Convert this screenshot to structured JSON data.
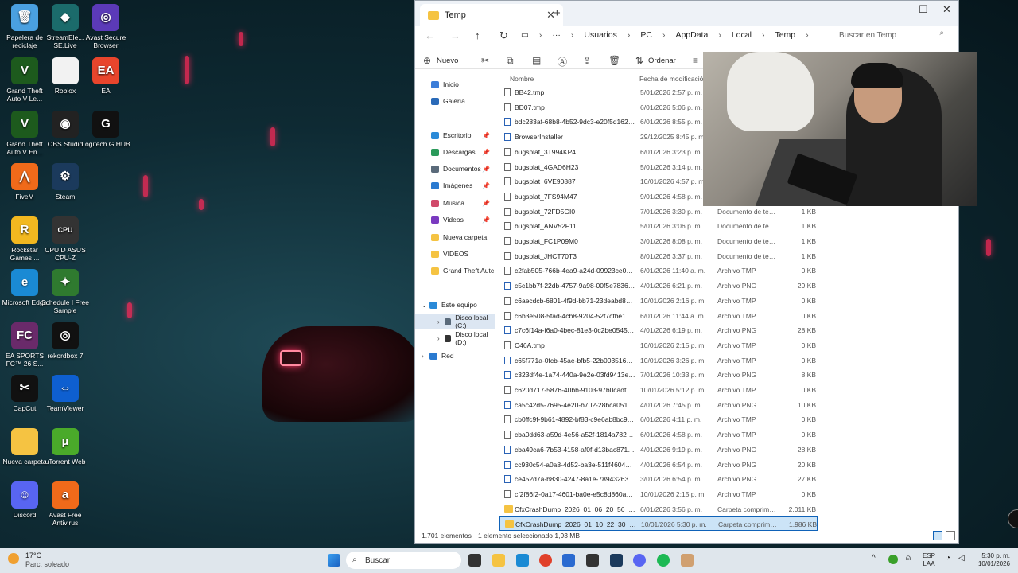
{
  "desktop": {
    "icons": [
      {
        "label": "Papelera de reciclaje",
        "icon": "recycle-bin-icon",
        "color": "#4aa0e0",
        "glyph": "🗑"
      },
      {
        "label": "StreamEle... SE.Live",
        "icon": "streamelements-icon",
        "color": "#1b6b6b",
        "glyph": "◆"
      },
      {
        "label": "Avast Secure Browser",
        "icon": "avast-browser-icon",
        "color": "#5b3ab8",
        "glyph": "◎"
      },
      {
        "label": "Grand Theft Auto V Le...",
        "icon": "gta-icon",
        "color": "#1d5a1d",
        "glyph": "V"
      },
      {
        "label": "Roblox",
        "icon": "file-icon",
        "color": "#f2f2f2",
        "glyph": ""
      },
      {
        "label": "EA",
        "icon": "ea-icon",
        "color": "#e8452c",
        "glyph": "EA"
      },
      {
        "label": "Grand Theft Auto V En...",
        "icon": "gta-icon",
        "color": "#1d5a1d",
        "glyph": "V"
      },
      {
        "label": "OBS Studio",
        "icon": "obs-icon",
        "color": "#222222",
        "glyph": "◉"
      },
      {
        "label": "Logitech G HUB",
        "icon": "logitech-icon",
        "color": "#111111",
        "glyph": "G"
      },
      {
        "label": "FiveM",
        "icon": "fivem-icon",
        "color": "#f06a1a",
        "glyph": "⋀"
      },
      {
        "label": "Steam",
        "icon": "steam-icon",
        "color": "#1b3a5c",
        "glyph": "⚙"
      },
      {
        "label": "Rockstar Games ...",
        "icon": "rockstar-icon",
        "color": "#f2b820",
        "glyph": "R"
      },
      {
        "label": "CPUID ASUS CPU-Z",
        "icon": "cpuz-icon",
        "color": "#333333",
        "glyph": "CPU"
      },
      {
        "label": "Microsoft Edge",
        "icon": "edge-icon",
        "color": "#1a8ad4",
        "glyph": "e"
      },
      {
        "label": "Schedule I Free Sample",
        "icon": "schedule-icon",
        "color": "#2f7a2f",
        "glyph": "✦"
      },
      {
        "label": "EA SPORTS FC™ 26 S...",
        "icon": "easports-icon",
        "color": "#6a2a6a",
        "glyph": "FC"
      },
      {
        "label": "rekordbox 7",
        "icon": "rekordbox-icon",
        "color": "#111111",
        "glyph": "◎"
      },
      {
        "label": "CapCut",
        "icon": "capcut-icon",
        "color": "#111111",
        "glyph": "✂"
      },
      {
        "label": "TeamViewer",
        "icon": "teamviewer-icon",
        "color": "#0e5fd0",
        "glyph": "⇔"
      },
      {
        "label": "Nueva carpeta",
        "icon": "folder-icon",
        "color": "#f5c342",
        "glyph": ""
      },
      {
        "label": "uTorrent Web",
        "icon": "utorrent-icon",
        "color": "#4aaa2a",
        "glyph": "µ"
      },
      {
        "label": "Discord",
        "icon": "discord-icon",
        "color": "#5865f2",
        "glyph": "☺"
      },
      {
        "label": "Avast Free Antivirus",
        "icon": "avast-icon",
        "color": "#f06a1a",
        "glyph": "a"
      }
    ]
  },
  "explorer": {
    "tab_title": "Temp",
    "breadcrumb": [
      "Usuarios",
      "PC",
      "AppData",
      "Local",
      "Temp"
    ],
    "ellipsis": "···",
    "search_placeholder": "Buscar en Temp",
    "toolbar": {
      "new_label": "Nuevo",
      "sort_label": "Ordenar"
    },
    "sidebar": [
      {
        "label": "Inicio",
        "icon": "home-icon",
        "color": "#3b7dd8",
        "pinned": false
      },
      {
        "label": "Galería",
        "icon": "gallery-icon",
        "color": "#2a6ab8",
        "pinned": false
      },
      {
        "label": "Escritorio",
        "icon": "desktop-icon",
        "color": "#2a8ad8",
        "pinned": true
      },
      {
        "label": "Descargas",
        "icon": "download-icon",
        "color": "#2a9a5a",
        "pinned": true
      },
      {
        "label": "Documentos",
        "icon": "documents-icon",
        "color": "#5a6a7a",
        "pinned": true
      },
      {
        "label": "Imágenes",
        "icon": "pictures-icon",
        "color": "#2a7ad0",
        "pinned": true
      },
      {
        "label": "Música",
        "icon": "music-icon",
        "color": "#d04a6a",
        "pinned": true
      },
      {
        "label": "Videos",
        "icon": "videos-icon",
        "color": "#7a3ac0",
        "pinned": true
      },
      {
        "label": "Nueva carpeta",
        "icon": "folder-icon",
        "color": "#f5c342",
        "pinned": false
      },
      {
        "label": "VIDEOS",
        "icon": "folder-icon",
        "color": "#f5c342",
        "pinned": false
      },
      {
        "label": "Grand Theft Autc",
        "icon": "folder-icon",
        "color": "#f5c342",
        "pinned": false
      },
      {
        "label": "Este equipo",
        "icon": "pc-icon",
        "color": "#2a8ad8",
        "pinned": false
      },
      {
        "label": "Disco local (C:)",
        "icon": "drive-icon",
        "color": "#5a6a7a",
        "pinned": false
      },
      {
        "label": "Disco local (D:)",
        "icon": "drive-icon",
        "color": "#333333",
        "pinned": false
      },
      {
        "label": "Red",
        "icon": "network-icon",
        "color": "#2a7ad0",
        "pinned": false
      }
    ],
    "columns": {
      "name": "Nombre",
      "date": "Fecha de modificación"
    },
    "files": [
      {
        "name": "BB42.tmp",
        "date": "5/01/2026 2:57 p. m.",
        "type": "",
        "size": "",
        "kind": "tmp"
      },
      {
        "name": "BD07.tmp",
        "date": "6/01/2026 5:06 p. m.",
        "type": "",
        "size": "",
        "kind": "tmp"
      },
      {
        "name": "bdc283af-68b8-4b52-9dc3-e20f5d16237c",
        "date": "6/01/2026 8:55 p. m.",
        "type": "",
        "size": "",
        "kind": "png"
      },
      {
        "name": "BrowserInstaller",
        "date": "29/12/2025 8:45 p. m.",
        "type": "",
        "size": "",
        "kind": "png"
      },
      {
        "name": "bugsplat_3T994KP4",
        "date": "6/01/2026 3:23 p. m.",
        "type": "",
        "size": "",
        "kind": "tmp"
      },
      {
        "name": "bugsplat_4GAD6H23",
        "date": "5/01/2026 3:14 p. m.",
        "type": "",
        "size": "",
        "kind": "tmp"
      },
      {
        "name": "bugsplat_6VE90887",
        "date": "10/01/2026 4:57 p. m.",
        "type": "",
        "size": "",
        "kind": "tmp"
      },
      {
        "name": "bugsplat_7FS94M47",
        "date": "9/01/2026 4:58 p. m.",
        "type": "",
        "size": "",
        "kind": "tmp"
      },
      {
        "name": "bugsplat_72FD5GI0",
        "date": "7/01/2026 3:30 p. m.",
        "type": "Documento de tex...",
        "size": "1 KB",
        "kind": "tmp"
      },
      {
        "name": "bugsplat_ANV52F11",
        "date": "5/01/2026 3:06 p. m.",
        "type": "Documento de tex...",
        "size": "1 KB",
        "kind": "tmp"
      },
      {
        "name": "bugsplat_FC1P09M0",
        "date": "3/01/2026 8:08 p. m.",
        "type": "Documento de tex...",
        "size": "1 KB",
        "kind": "tmp"
      },
      {
        "name": "bugsplat_JHCT70T3",
        "date": "8/01/2026 3:37 p. m.",
        "type": "Documento de tex...",
        "size": "1 KB",
        "kind": "tmp"
      },
      {
        "name": "c2fab505-766b-4ea9-a24d-09923ce092dc....",
        "date": "6/01/2026 11:40 a. m.",
        "type": "Archivo TMP",
        "size": "0 KB",
        "kind": "tmp"
      },
      {
        "name": "c5c1bb7f-22db-4757-9a98-00f5e7836ed4",
        "date": "4/01/2026 6:21 p. m.",
        "type": "Archivo PNG",
        "size": "29 KB",
        "kind": "png"
      },
      {
        "name": "c6aecdcb-6801-4f9d-bb71-23deabd87de...",
        "date": "10/01/2026 2:16 p. m.",
        "type": "Archivo TMP",
        "size": "0 KB",
        "kind": "tmp"
      },
      {
        "name": "c6b3e508-5fad-4cb8-9204-52f7cfbe10a4.t...",
        "date": "6/01/2026 11:44 a. m.",
        "type": "Archivo TMP",
        "size": "0 KB",
        "kind": "tmp"
      },
      {
        "name": "c7c6f14a-f6a0-4bec-81e3-0c2be0545dfe",
        "date": "4/01/2026 6:19 p. m.",
        "type": "Archivo PNG",
        "size": "28 KB",
        "kind": "png"
      },
      {
        "name": "C46A.tmp",
        "date": "10/01/2026 2:15 p. m.",
        "type": "Archivo TMP",
        "size": "0 KB",
        "kind": "tmp"
      },
      {
        "name": "c65f771a-0fcb-45ae-bfb5-22b003516266.t...",
        "date": "10/01/2026 3:26 p. m.",
        "type": "Archivo TMP",
        "size": "0 KB",
        "kind": "png"
      },
      {
        "name": "c323df4e-1a74-440a-9e2e-03fd9413e1cf",
        "date": "7/01/2026 10:33 p. m.",
        "type": "Archivo PNG",
        "size": "8 KB",
        "kind": "png"
      },
      {
        "name": "c620d717-5876-40bb-9103-97b0cadf18b1....",
        "date": "10/01/2026 5:12 p. m.",
        "type": "Archivo TMP",
        "size": "0 KB",
        "kind": "tmp"
      },
      {
        "name": "ca5c42d5-7695-4e20-b702-28bca0512048",
        "date": "4/01/2026 7:45 p. m.",
        "type": "Archivo PNG",
        "size": "10 KB",
        "kind": "png"
      },
      {
        "name": "cb0ffc9f-9b61-4892-bf83-c9e6ab8bc933.t...",
        "date": "6/01/2026 4:11 p. m.",
        "type": "Archivo TMP",
        "size": "0 KB",
        "kind": "tmp"
      },
      {
        "name": "cba0dd63-a59d-4e56-a52f-1814a78296fb....",
        "date": "6/01/2026 4:58 p. m.",
        "type": "Archivo TMP",
        "size": "0 KB",
        "kind": "tmp"
      },
      {
        "name": "cba49ca6-7b53-4158-af0f-d13bac871978",
        "date": "4/01/2026 9:19 p. m.",
        "type": "Archivo PNG",
        "size": "28 KB",
        "kind": "png"
      },
      {
        "name": "cc930c54-a0a8-4d52-ba3e-511f4604b83e",
        "date": "4/01/2026 6:54 p. m.",
        "type": "Archivo PNG",
        "size": "20 KB",
        "kind": "png"
      },
      {
        "name": "ce452d7a-b830-4247-8a1e-789432632e83",
        "date": "3/01/2026 6:54 p. m.",
        "type": "Archivo PNG",
        "size": "27 KB",
        "kind": "png"
      },
      {
        "name": "cf2f86f2-0a17-4601-ba0e-e5c8d860a025.t...",
        "date": "10/01/2026 2:15 p. m.",
        "type": "Archivo TMP",
        "size": "0 KB",
        "kind": "tmp"
      },
      {
        "name": "CfxCrashDump_2026_01_06_20_56_29",
        "date": "6/01/2026 3:56 p. m.",
        "type": "Carpeta comprimi...",
        "size": "2.011 KB",
        "kind": "zip"
      },
      {
        "name": "CfxCrashDump_2026_01_10_22_30_33",
        "date": "10/01/2026 5:30 p. m.",
        "type": "Carpeta comprimi...",
        "size": "1.986 KB",
        "kind": "zip",
        "selected": true
      }
    ],
    "status": {
      "count": "1.701 elementos",
      "selection": "1 elemento seleccionado  1,93 MB"
    }
  },
  "taskbar": {
    "weather_temp": "17°C",
    "weather_desc": "Parc. soleado",
    "search_placeholder": "Buscar",
    "lang": "ESP",
    "lang2": "LAA",
    "time": "5:30 p. m.",
    "date": "10/01/2026",
    "apps": [
      {
        "icon": "windows-start-icon",
        "color": "#1a78d4"
      },
      {
        "icon": "task-view-icon",
        "color": "#333333"
      },
      {
        "icon": "file-explorer-icon",
        "color": "#f5c342"
      },
      {
        "icon": "edge-icon",
        "color": "#1a8ad4"
      },
      {
        "icon": "chrome-icon",
        "color": "#e0402a"
      },
      {
        "icon": "store-icon",
        "color": "#2a6ad0"
      },
      {
        "icon": "epic-icon",
        "color": "#333333"
      },
      {
        "icon": "steam-icon",
        "color": "#1b3a5c"
      },
      {
        "icon": "discord-icon",
        "color": "#5865f2"
      },
      {
        "icon": "spotify-icon",
        "color": "#1db954"
      },
      {
        "icon": "app-icon",
        "color": "#d0a070"
      }
    ]
  }
}
